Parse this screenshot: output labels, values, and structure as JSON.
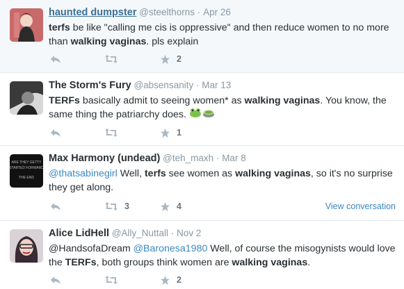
{
  "tweets": [
    {
      "name": "haunted dumpster",
      "handle": "@steelthorns",
      "sep": "·",
      "time": "Apr 26",
      "text_parts": [
        {
          "t": "terfs",
          "b": true
        },
        {
          "t": " be like \"calling me cis is oppressive\" and then reduce women to no more than "
        },
        {
          "t": "walking vaginas",
          "b": true
        },
        {
          "t": ". pls explain"
        }
      ],
      "retweets": "",
      "favorites": "2"
    },
    {
      "name": "The Storm's Fury",
      "handle": "@absensanity",
      "sep": "·",
      "time": "Mar 13",
      "text_parts": [
        {
          "t": "TERFs",
          "b": true
        },
        {
          "t": " basically admit to seeing women* as "
        },
        {
          "t": "walking vaginas",
          "b": true
        },
        {
          "t": ". You know, the same thing the patriarchy does. "
        }
      ],
      "retweets": "",
      "favorites": "1"
    },
    {
      "name": "Max Harmony (undead)",
      "handle": "@teh_maxh",
      "sep": "·",
      "time": "Mar 8",
      "text_parts": [
        {
          "t": "@thatsabinegirl",
          "m": true
        },
        {
          "t": " Well, "
        },
        {
          "t": "terfs",
          "b": true
        },
        {
          "t": " see women as "
        },
        {
          "t": "walking vaginas",
          "b": true
        },
        {
          "t": ", so it's no surprise they get along."
        }
      ],
      "retweets": "3",
      "favorites": "4",
      "view_conversation": "View conversation"
    },
    {
      "name": "Alice LidHell",
      "handle": "@Ally_Nuttall",
      "sep": "·",
      "time": "Nov 2",
      "text_parts": [
        {
          "t": "@HandsofaDream "
        },
        {
          "t": "@Baronesa1980",
          "m": true
        },
        {
          "t": " Well, of course the misogynists would love the "
        },
        {
          "t": "TERFs",
          "b": true
        },
        {
          "t": ", both groups think women are "
        },
        {
          "t": "walking vaginas",
          "b": true
        },
        {
          "t": "."
        }
      ],
      "retweets": "",
      "favorites": "2"
    }
  ],
  "avatar_text": {
    "max": "ARE THEY GETTY STARTED FORWARD THE END"
  },
  "icons": {
    "reply": "reply-icon",
    "retweet": "retweet-icon",
    "favorite": "star-icon"
  },
  "colors": {
    "link": "#3b88c3",
    "muted": "#8899a6",
    "highlight_bg": "#f5f8fa"
  }
}
